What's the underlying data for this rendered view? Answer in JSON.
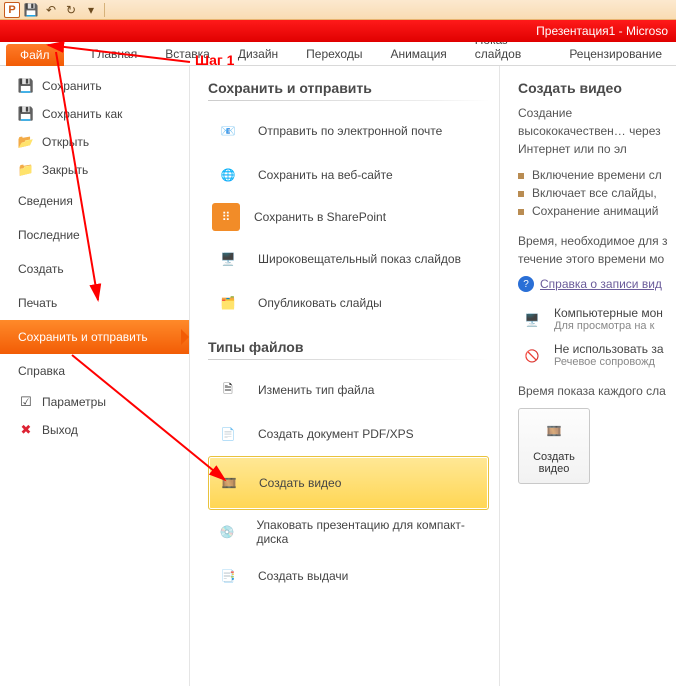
{
  "window": {
    "title": "Презентация1 - Microso"
  },
  "qat_icons": [
    "save",
    "undo",
    "redo"
  ],
  "tabs": {
    "file": "Файл",
    "items": [
      "Главная",
      "Вставка",
      "Дизайн",
      "Переходы",
      "Анимация",
      "Показ слайдов",
      "Рецензирование"
    ]
  },
  "step_label": "Шаг 1",
  "left_menu": {
    "save": "Сохранить",
    "save_as": "Сохранить как",
    "open": "Открыть",
    "close": "Закрыть",
    "info": "Сведения",
    "recent": "Последние",
    "new": "Создать",
    "print": "Печать",
    "save_send": "Сохранить и отправить",
    "help": "Справка",
    "options": "Параметры",
    "exit": "Выход"
  },
  "mid": {
    "h1": "Сохранить и отправить",
    "opts1": [
      {
        "icon": "mail",
        "label": "Отправить по электронной почте"
      },
      {
        "icon": "web",
        "label": "Сохранить на веб-сайте"
      },
      {
        "icon": "sharepoint",
        "label": "Сохранить в SharePoint"
      },
      {
        "icon": "broadcast",
        "label": "Широковещательный показ слайдов"
      },
      {
        "icon": "publish",
        "label": "Опубликовать слайды"
      }
    ],
    "h2": "Типы файлов",
    "opts2": [
      {
        "icon": "changetype",
        "label": "Изменить тип файла"
      },
      {
        "icon": "pdf",
        "label": "Создать документ PDF/XPS"
      },
      {
        "icon": "video",
        "label": "Создать видео",
        "selected": true
      },
      {
        "icon": "cd",
        "label": "Упаковать презентацию для компакт-диска"
      },
      {
        "icon": "handout",
        "label": "Создать выдачи"
      }
    ]
  },
  "right": {
    "h": "Создать видео",
    "desc": "Создание высококачествен… через Интернет или по эл",
    "bullets": [
      "Включение времени сл",
      "Включает все слайды,",
      "Сохранение анимаций"
    ],
    "time_note1": "Время, необходимое для з",
    "time_note2": "течение этого времени мо",
    "help_link": "Справка о записи вид",
    "card1_t": "Компьютерные мон",
    "card1_s": "Для просмотра на к",
    "card2_t": "Не использовать за",
    "card2_s": "Речевое сопровожд",
    "duration_label": "Время показа каждого сла",
    "bigbtn": "Создать видео"
  }
}
